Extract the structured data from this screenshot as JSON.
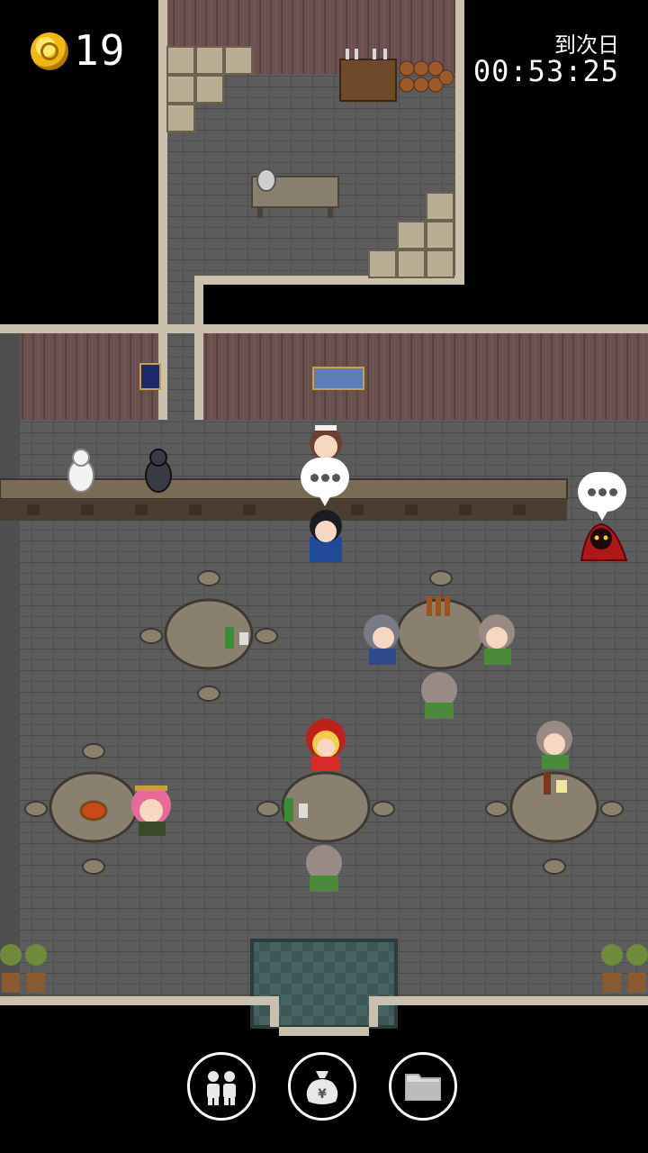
{
  "hud": {
    "coins": "19",
    "coin_icon": "gold-coin-icon",
    "time_label": "到次日",
    "time_value": "00:53:25"
  },
  "toolbar": {
    "buttons": [
      {
        "name": "party-button",
        "icon": "people-icon"
      },
      {
        "name": "money-bag-button",
        "icon": "money-bag-icon"
      },
      {
        "name": "folder-button",
        "icon": "folder-icon"
      }
    ]
  },
  "scene": {
    "location": "tavern",
    "speech_bubbles": [
      "…",
      "…"
    ],
    "colors": {
      "floor": "#5b5b5b",
      "wall": "#6a4f4f",
      "bar_counter": "#7a6a58",
      "table": "#8a8070",
      "exit_mat": "#3f5858",
      "hooded_figure": "#b01818"
    }
  }
}
